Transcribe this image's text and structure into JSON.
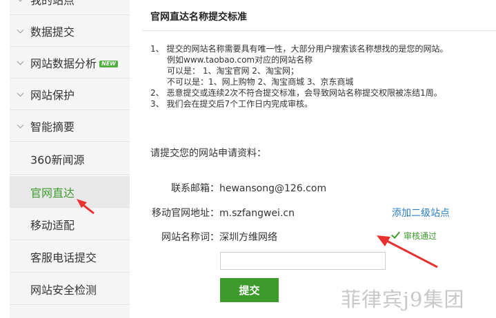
{
  "sidebar": {
    "items": [
      {
        "label": "我的站点",
        "expandable": true,
        "partial": true
      },
      {
        "label": "数据提交",
        "expandable": true
      },
      {
        "label": "网站数据分析",
        "expandable": true,
        "badge": "NEW"
      },
      {
        "label": "网站保护",
        "expandable": true
      },
      {
        "label": "智能摘要",
        "expandable": true
      },
      {
        "label": "360新闻源",
        "expandable": false
      },
      {
        "label": "官网直达",
        "expandable": false,
        "active": true
      },
      {
        "label": "移动适配",
        "expandable": false
      },
      {
        "label": "客服电话提交",
        "expandable": false
      },
      {
        "label": "网站安全检测",
        "expandable": false
      }
    ]
  },
  "main": {
    "title": "官网直达名称提交标准",
    "rules": [
      "1、 提交的网站名称需要具有唯一性，大部分用户搜索该名称想找的是您的网站。",
      "例如www.taobao.com对应的网站名称",
      "可以是： 1、淘宝官网 2、淘宝网；",
      "不可以是：1、网上购物 2、淘宝商城 3、京东商城",
      "2、 恶意提交或连续2次不符合提交标准，会导致网站名称提交权限被冻结1周。",
      "3、 我们会在提交后7个工作日内完成审核。"
    ],
    "form_intro": "请提交您的网站申请资料：",
    "email_label": "联系邮箱：",
    "email_value": "hewansong@126.com",
    "mobile_label": "移动官网地址：",
    "mobile_value": "m.szfangwei.cn",
    "add_link": "添加二级站点",
    "name_label": "网站名称词：",
    "name_value": "深圳方维网络",
    "status": "审核通过",
    "submit_label": "提交"
  },
  "watermark": "菲律宾j9集团",
  "colors": {
    "accent": "#3c9b2b",
    "link": "#2a7ec9",
    "arrow": "#e8302f"
  }
}
